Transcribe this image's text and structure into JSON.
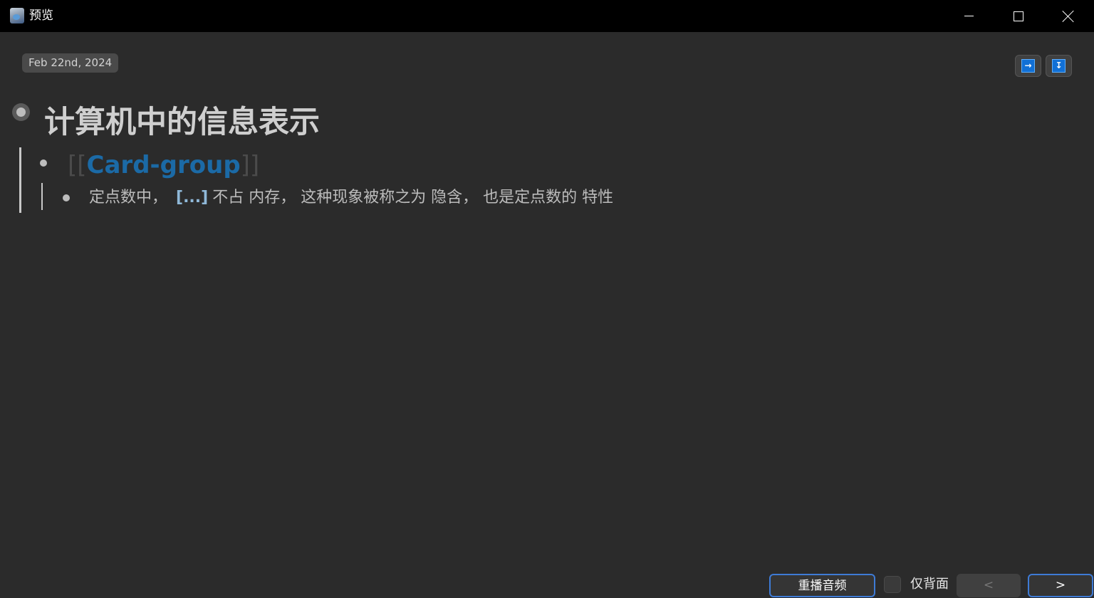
{
  "window": {
    "title": "预览",
    "controls": {
      "minimize": "minimize-icon",
      "maximize": "maximize-icon",
      "close": "close-icon"
    }
  },
  "journal": {
    "date": "Feb 22nd, 2024",
    "toolbar": [
      {
        "icon": "expand-right-icon",
        "glyph": "→"
      },
      {
        "icon": "collapse-down-icon",
        "glyph": "↧"
      }
    ]
  },
  "page": {
    "title": "计算机中的信息表示",
    "link": {
      "open": "[[",
      "text": "Card-group",
      "close": "]]"
    },
    "block": {
      "before": "定点数中，",
      "cloze": "[...]",
      "after": "不占 内存， 这种现象被称之为 隐含， 也是定点数的 特性"
    }
  },
  "footer": {
    "replay_label": "重播音频",
    "back_only_label": "仅背面",
    "back_only_checked": false,
    "prev_label": "<",
    "next_label": ">"
  },
  "colors": {
    "accent": "#3e7bd6",
    "link": "#1b6aa6",
    "background": "#2b2b2b"
  }
}
